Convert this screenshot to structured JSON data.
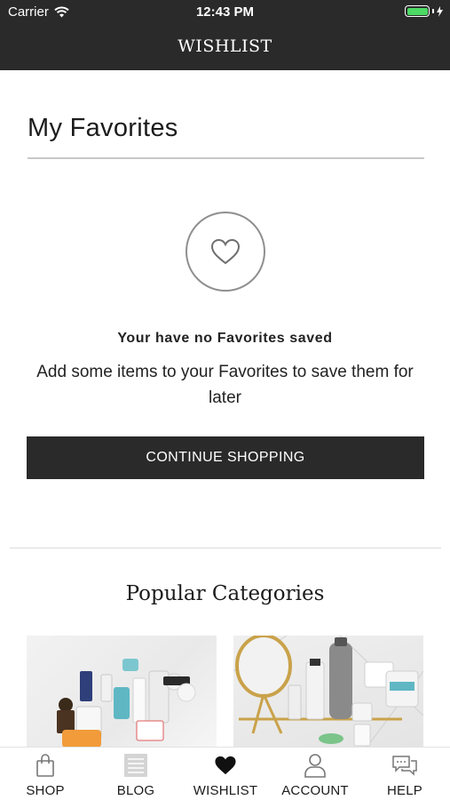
{
  "status_bar": {
    "carrier": "Carrier",
    "time": "12:43 PM",
    "battery_color": "#4cd964"
  },
  "nav": {
    "title": "WISHLIST"
  },
  "favorites": {
    "title": "My Favorites",
    "empty_title": "Your have no Favorites saved",
    "empty_desc": "Add some items to your Favorites to save them for later",
    "cta_label": "CONTINUE SHOPPING",
    "icon": "heart-outline-icon"
  },
  "categories": {
    "title": "Popular Categories"
  },
  "tabbar": {
    "items": [
      {
        "label": "SHOP",
        "icon": "shopping-bag-icon"
      },
      {
        "label": "BLOG",
        "icon": "blog-icon"
      },
      {
        "label": "WISHLIST",
        "icon": "heart-filled-icon",
        "active": true
      },
      {
        "label": "ACCOUNT",
        "icon": "person-icon"
      },
      {
        "label": "HELP",
        "icon": "chat-bubbles-icon"
      }
    ]
  },
  "colors": {
    "header_bg": "#2a2a2a",
    "cta_bg": "#2a2a2a",
    "accent": "#4cd964"
  }
}
